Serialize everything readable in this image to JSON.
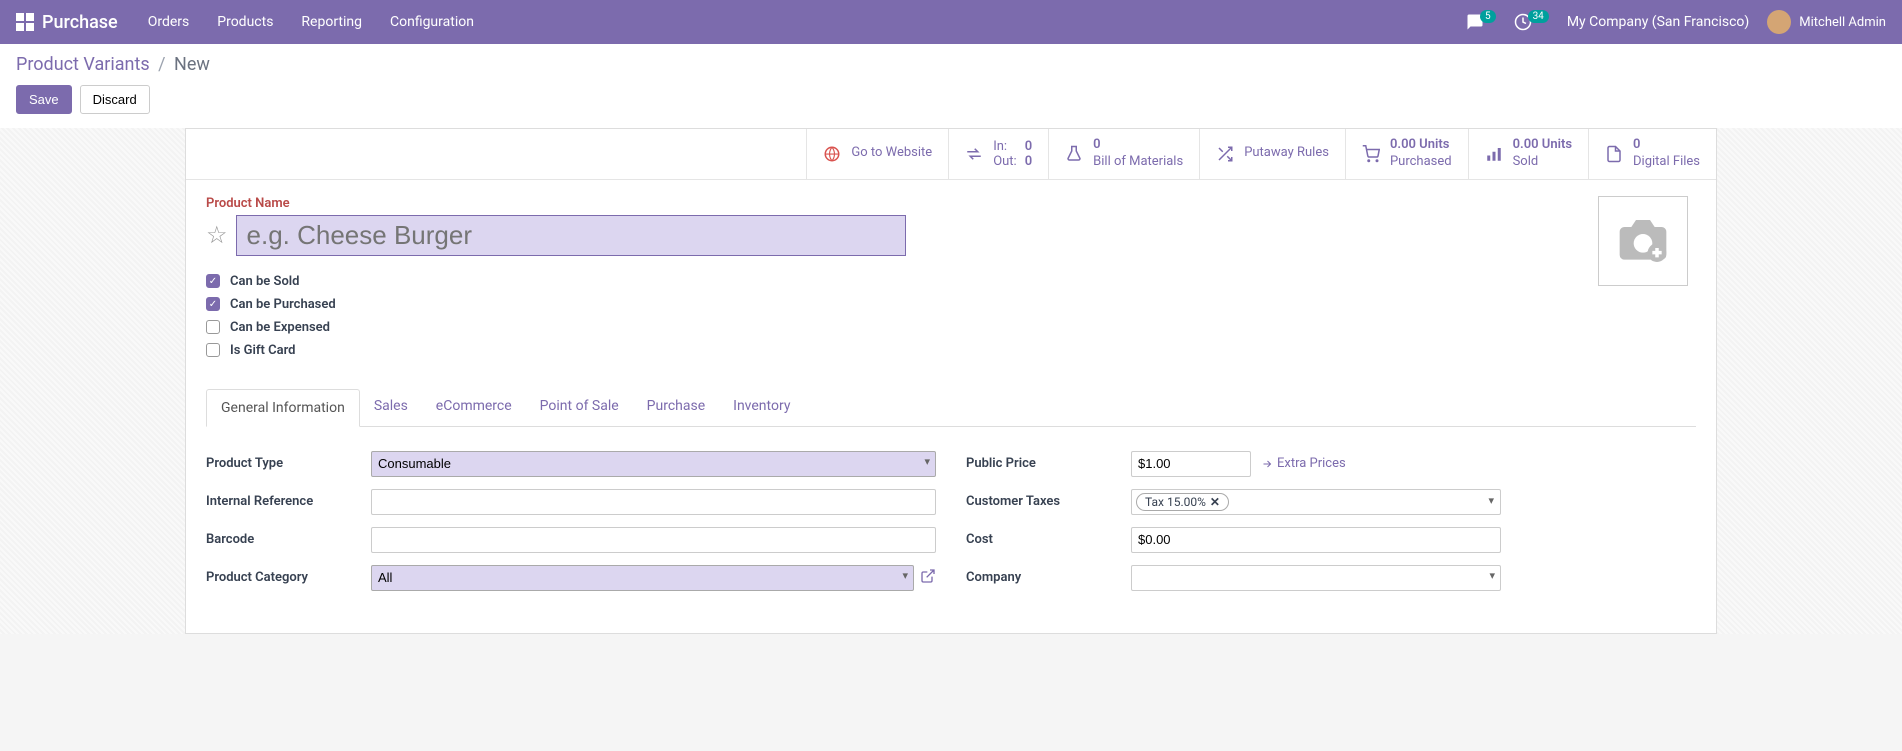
{
  "nav": {
    "brand": "Purchase",
    "items": [
      "Orders",
      "Products",
      "Reporting",
      "Configuration"
    ],
    "msg_badge": "5",
    "clock_badge": "34",
    "company": "My Company (San Francisco)",
    "user": "Mitchell Admin"
  },
  "breadcrumb": {
    "root": "Product Variants",
    "current": "New"
  },
  "actions": {
    "save": "Save",
    "discard": "Discard"
  },
  "stats": {
    "website": "Go to Website",
    "in_label": "In:",
    "in_val": "0",
    "out_label": "Out:",
    "out_val": "0",
    "bom_val": "0",
    "bom_label": "Bill of Materials",
    "putaway": "Putaway Rules",
    "purchased_val": "0.00 Units",
    "purchased_label": "Purchased",
    "sold_val": "0.00 Units",
    "sold_label": "Sold",
    "digital_val": "0",
    "digital_label": "Digital Files"
  },
  "form": {
    "name_label": "Product Name",
    "name_placeholder": "e.g. Cheese Burger",
    "checks": {
      "sold": "Can be Sold",
      "purchased": "Can be Purchased",
      "expensed": "Can be Expensed",
      "gift": "Is Gift Card"
    },
    "tabs": [
      "General Information",
      "Sales",
      "eCommerce",
      "Point of Sale",
      "Purchase",
      "Inventory"
    ],
    "fields": {
      "product_type": "Product Type",
      "product_type_val": "Consumable",
      "internal_ref": "Internal Reference",
      "barcode": "Barcode",
      "category": "Product Category",
      "category_val": "All",
      "public_price": "Public Price",
      "public_price_val": "$1.00",
      "extra_prices": "Extra Prices",
      "customer_taxes": "Customer Taxes",
      "tax_tag": "Tax 15.00%",
      "cost": "Cost",
      "cost_val": "$0.00",
      "company": "Company"
    }
  }
}
